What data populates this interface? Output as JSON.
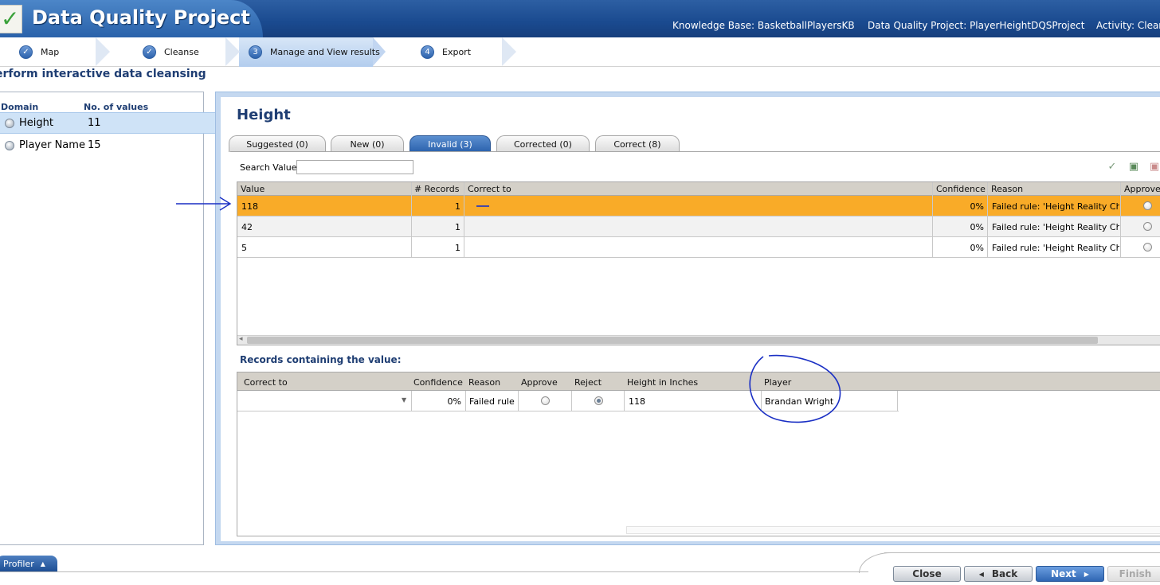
{
  "app": {
    "title": "Data Quality Project",
    "knowledge_base": "Knowledge Base: BasketballPlayersKB",
    "project": "Data Quality Project: PlayerHeightDQSProject",
    "activity": "Activity: Cleanse"
  },
  "steps": [
    {
      "num": "",
      "label": "Map",
      "icon": "check-icon"
    },
    {
      "num": "",
      "label": "Cleanse",
      "icon": "check-icon"
    },
    {
      "num": "3",
      "label": "Manage and View results"
    },
    {
      "num": "4",
      "label": "Export"
    }
  ],
  "page_heading": "erform interactive data cleansing",
  "domains": {
    "header_domain": "Domain",
    "header_count": "No. of values",
    "items": [
      {
        "name": "Height",
        "count": "11",
        "selected": true
      },
      {
        "name": "Player Name",
        "count": "15",
        "selected": false
      }
    ]
  },
  "main": {
    "domain_title": "Height",
    "tabs": [
      {
        "label": "Suggested (0)"
      },
      {
        "label": "New (0)"
      },
      {
        "label": "Invalid (3)",
        "active": true
      },
      {
        "label": "Corrected (0)"
      },
      {
        "label": "Correct (8)"
      }
    ],
    "search_label": "Search Value:",
    "search_value": "",
    "grid": {
      "headers": [
        "Value",
        "# Records",
        "Correct to",
        "Confidence",
        "Reason",
        "Approve"
      ],
      "rows": [
        {
          "value": "118",
          "records": "1",
          "correct_to": "",
          "confidence": "0%",
          "reason": "Failed rule: 'Height Reality Check '",
          "selected": true
        },
        {
          "value": "42",
          "records": "1",
          "correct_to": "",
          "confidence": "0%",
          "reason": "Failed rule: 'Height Reality Check '"
        },
        {
          "value": "5",
          "records": "1",
          "correct_to": "",
          "confidence": "0%",
          "reason": "Failed rule: 'Height Reality Check '"
        }
      ]
    },
    "records_title": "Records containing the value:",
    "records_grid": {
      "headers": [
        "Correct to",
        "Confidence",
        "Reason",
        "Approve",
        "Reject",
        "Height in Inches",
        "Player"
      ],
      "row": {
        "correct_to": "",
        "confidence": "0%",
        "reason": "Failed rule: '",
        "approve": false,
        "reject": true,
        "height": "118",
        "player": "Brandan Wright"
      }
    }
  },
  "bottom": {
    "profiler_label": "Profiler",
    "close_label": "Close",
    "back_label": "Back",
    "next_label": "Next",
    "finish_label": "Finish"
  },
  "colors": {
    "selected_row": "#f9ab28",
    "accent": "#2b62ad",
    "heading": "#1f3e73",
    "annotation_ink": "#1a2fc4"
  }
}
